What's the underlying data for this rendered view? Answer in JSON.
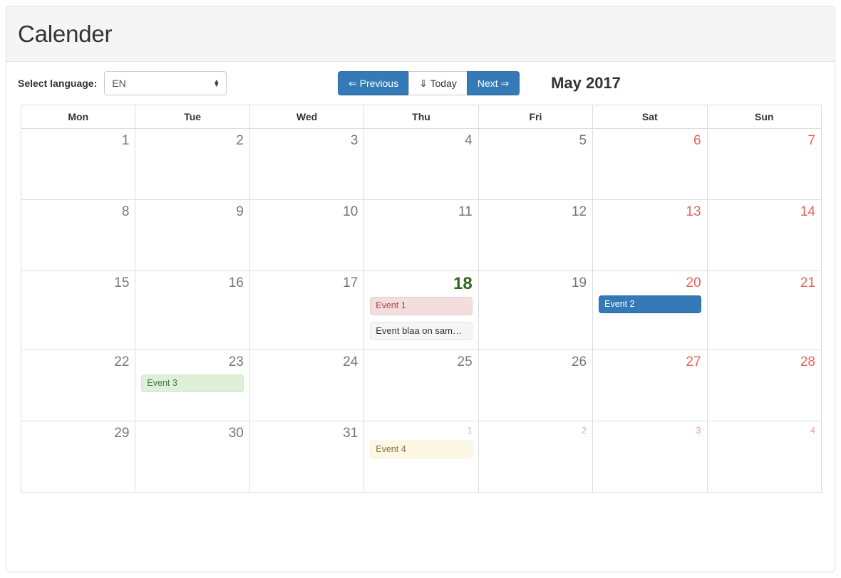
{
  "header": {
    "title": "Calender"
  },
  "toolbar": {
    "language_label": "Select language:",
    "language_value": "EN",
    "language_options": [
      "EN"
    ],
    "previous_label": "⇐ Previous",
    "today_label": "⇓ Today",
    "next_label": "Next ⇒",
    "month_title": "May 2017"
  },
  "calendar": {
    "weekdays": [
      "Mon",
      "Tue",
      "Wed",
      "Thu",
      "Fri",
      "Sat",
      "Sun"
    ],
    "weeks": [
      [
        {
          "day": "1",
          "type": "current",
          "weekend": false,
          "events": []
        },
        {
          "day": "2",
          "type": "current",
          "weekend": false,
          "events": []
        },
        {
          "day": "3",
          "type": "current",
          "weekend": false,
          "events": []
        },
        {
          "day": "4",
          "type": "current",
          "weekend": false,
          "events": []
        },
        {
          "day": "5",
          "type": "current",
          "weekend": false,
          "events": []
        },
        {
          "day": "6",
          "type": "current",
          "weekend": true,
          "events": []
        },
        {
          "day": "7",
          "type": "current",
          "weekend": true,
          "events": []
        }
      ],
      [
        {
          "day": "8",
          "type": "current",
          "weekend": false,
          "events": []
        },
        {
          "day": "9",
          "type": "current",
          "weekend": false,
          "events": []
        },
        {
          "day": "10",
          "type": "current",
          "weekend": false,
          "events": []
        },
        {
          "day": "11",
          "type": "current",
          "weekend": false,
          "events": []
        },
        {
          "day": "12",
          "type": "current",
          "weekend": false,
          "events": []
        },
        {
          "day": "13",
          "type": "current",
          "weekend": true,
          "events": []
        },
        {
          "day": "14",
          "type": "current",
          "weekend": true,
          "events": []
        }
      ],
      [
        {
          "day": "15",
          "type": "current",
          "weekend": false,
          "events": []
        },
        {
          "day": "16",
          "type": "current",
          "weekend": false,
          "events": []
        },
        {
          "day": "17",
          "type": "current",
          "weekend": false,
          "events": []
        },
        {
          "day": "18",
          "type": "today",
          "weekend": false,
          "events": [
            {
              "label": "Event 1",
              "style": "danger"
            },
            {
              "label": "Event blaa on same day!",
              "style": "default"
            }
          ]
        },
        {
          "day": "19",
          "type": "current",
          "weekend": false,
          "events": []
        },
        {
          "day": "20",
          "type": "current",
          "weekend": true,
          "events": [
            {
              "label": "Event 2",
              "style": "primary"
            }
          ]
        },
        {
          "day": "21",
          "type": "current",
          "weekend": true,
          "events": []
        }
      ],
      [
        {
          "day": "22",
          "type": "current",
          "weekend": false,
          "events": []
        },
        {
          "day": "23",
          "type": "current",
          "weekend": false,
          "events": [
            {
              "label": "Event 3",
              "style": "success"
            }
          ]
        },
        {
          "day": "24",
          "type": "current",
          "weekend": false,
          "events": []
        },
        {
          "day": "25",
          "type": "current",
          "weekend": false,
          "events": []
        },
        {
          "day": "26",
          "type": "current",
          "weekend": false,
          "events": []
        },
        {
          "day": "27",
          "type": "current",
          "weekend": true,
          "events": []
        },
        {
          "day": "28",
          "type": "current",
          "weekend": true,
          "events": []
        }
      ],
      [
        {
          "day": "29",
          "type": "current",
          "weekend": false,
          "events": []
        },
        {
          "day": "30",
          "type": "current",
          "weekend": false,
          "events": []
        },
        {
          "day": "31",
          "type": "current",
          "weekend": false,
          "events": []
        },
        {
          "day": "1",
          "type": "other",
          "weekend": false,
          "events": [
            {
              "label": "Event 4",
              "style": "warning"
            }
          ]
        },
        {
          "day": "2",
          "type": "other",
          "weekend": false,
          "events": []
        },
        {
          "day": "3",
          "type": "other",
          "weekend": true,
          "events": []
        },
        {
          "day": "4",
          "type": "other",
          "weekend": true,
          "events": []
        }
      ]
    ]
  },
  "colors": {
    "primary": "#337ab7",
    "weekend": "#e8645a",
    "today_bg": "#e9f8e9",
    "today_text": "#2d6a1f",
    "event_danger_bg": "#f2dede",
    "event_danger_text": "#a94442",
    "event_success_bg": "#dff0d8",
    "event_success_text": "#3c763d",
    "event_warning_bg": "#fcf8e3",
    "event_warning_text": "#8a6d3b",
    "event_default_bg": "#f5f5f5",
    "other_month_bg": "#f5f5f5"
  }
}
